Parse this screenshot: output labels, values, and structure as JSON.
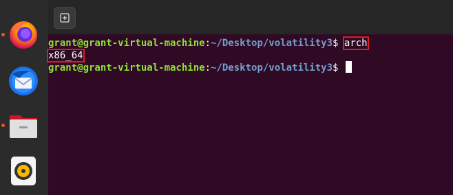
{
  "dock": {
    "items": [
      {
        "name": "firefox-icon",
        "running": true
      },
      {
        "name": "thunderbird-icon",
        "running": false
      },
      {
        "name": "files-icon",
        "running": true
      },
      {
        "name": "rhythmbox-icon",
        "running": false
      }
    ]
  },
  "titlebar": {
    "new_tab_icon": "new-tab-icon"
  },
  "terminal": {
    "lines": [
      {
        "user_host": "grant@grant-virtual-machine",
        "sep": ":",
        "path": "~/Desktop/volatility3",
        "prompt": "$ ",
        "command": "arch"
      },
      {
        "output": "x86_64"
      },
      {
        "user_host": "grant@grant-virtual-machine",
        "sep": ":",
        "path": "~/Desktop/volatility3",
        "prompt": "$ ",
        "command": ""
      }
    ]
  },
  "colors": {
    "terminal_bg": "#300a24",
    "user_color": "#8ae234",
    "path_color": "#729fcf",
    "highlight_box": "#e01b24",
    "dock_bg": "#2b2b2b"
  }
}
